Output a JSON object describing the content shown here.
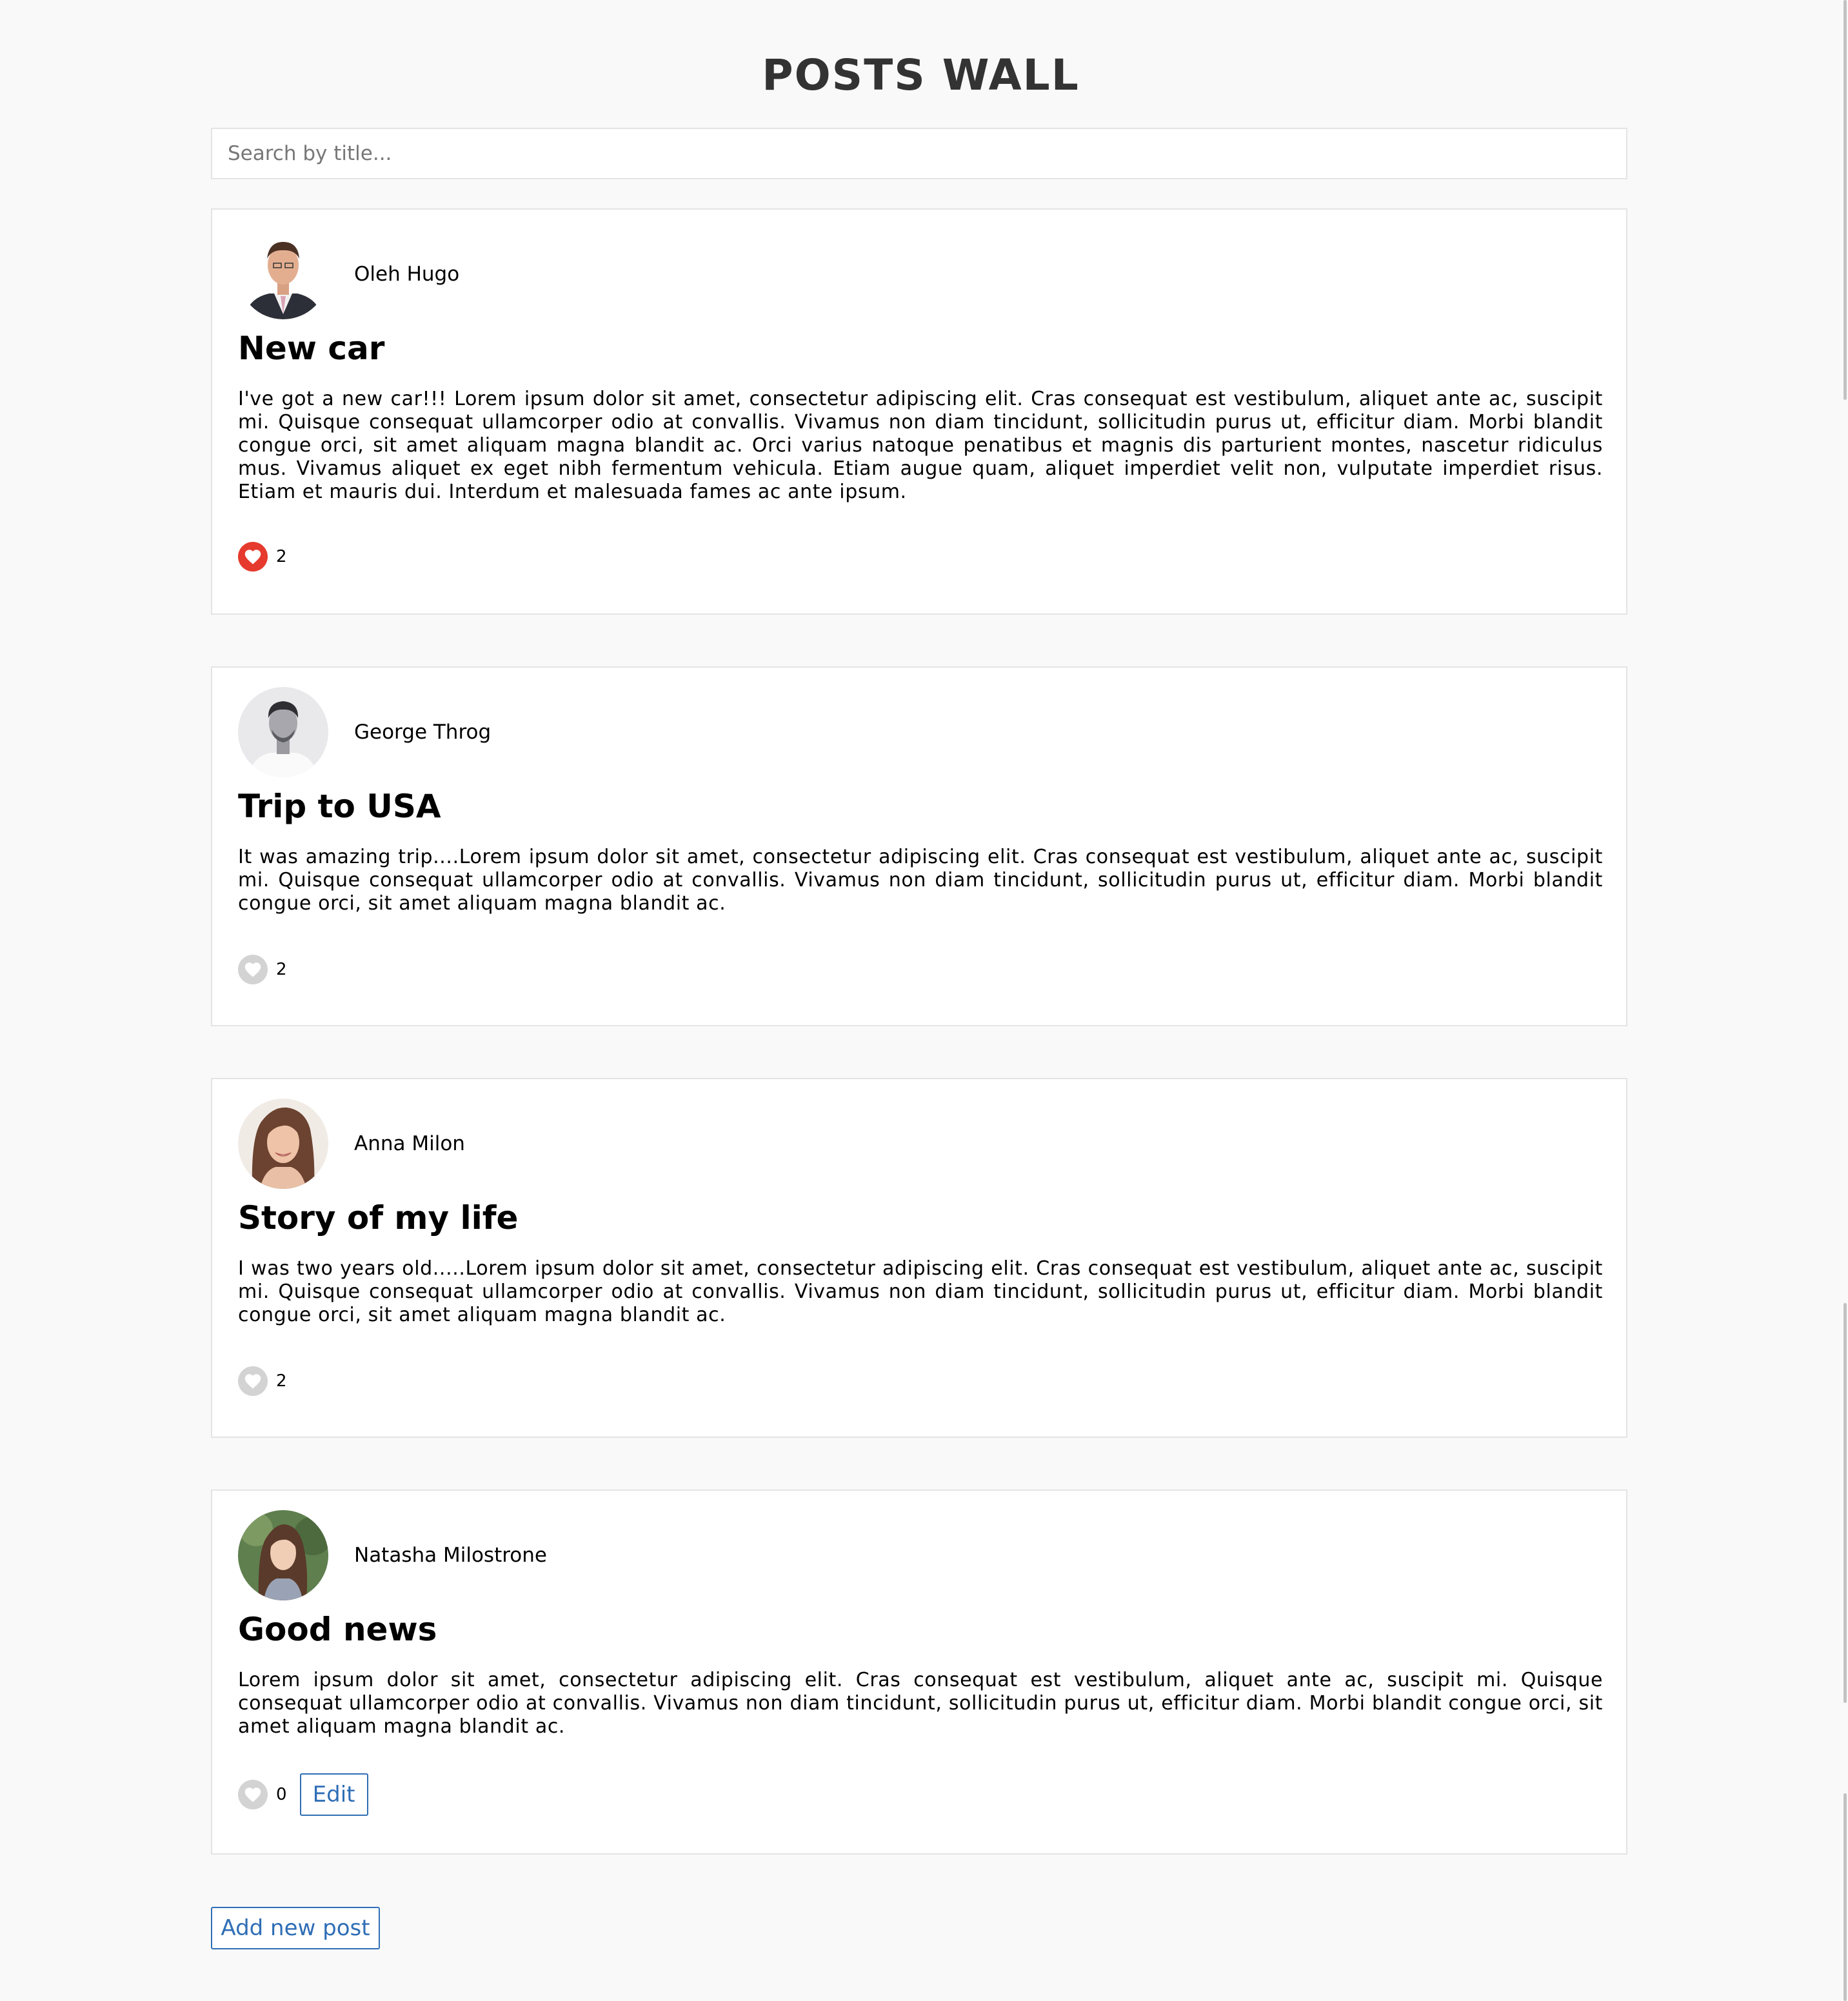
{
  "page": {
    "title": "POSTS WALL"
  },
  "search": {
    "placeholder": "Search by title...",
    "value": ""
  },
  "posts": [
    {
      "author": "Oleh Hugo",
      "title": "New car",
      "body": "I've got a new car!!! Lorem ipsum dolor sit amet, consectetur adipiscing elit. Cras consequat est vestibulum, aliquet ante ac, suscipit mi. Quisque consequat ullamcorper odio at convallis. Vivamus non diam tincidunt, sollicitudin purus ut, efficitur diam. Morbi blandit congue orci, sit amet aliquam magna blandit ac. Orci varius natoque penatibus et magnis dis parturient montes, nascetur ridiculus mus. Vivamus aliquet ex eget nibh fermentum vehicula. Etiam augue quam, aliquet imperdiet velit non, vulputate imperdiet risus. Etiam et mauris dui. Interdum et malesuada fames ac ante ipsum.",
      "likes": "2",
      "liked": true
    },
    {
      "author": "George Throg",
      "title": "Trip to USA",
      "body": "It was amazing trip....Lorem ipsum dolor sit amet, consectetur adipiscing elit. Cras consequat est vestibulum, aliquet ante ac, suscipit mi. Quisque consequat ullamcorper odio at convallis. Vivamus non diam tincidunt, sollicitudin purus ut, efficitur diam. Morbi blandit congue orci, sit amet aliquam magna blandit ac.",
      "likes": "2",
      "liked": false
    },
    {
      "author": "Anna Milon",
      "title": "Story of my life",
      "body": "I was two years old.....Lorem ipsum dolor sit amet, consectetur adipiscing elit. Cras consequat est vestibulum, aliquet ante ac, suscipit mi. Quisque consequat ullamcorper odio at convallis. Vivamus non diam tincidunt, sollicitudin purus ut, efficitur diam. Morbi blandit congue orci, sit amet aliquam magna blandit ac.",
      "likes": "2",
      "liked": false
    },
    {
      "author": "Natasha Milostrone",
      "title": "Good news",
      "body": "Lorem ipsum dolor sit amet, consectetur adipiscing elit. Cras consequat est vestibulum, aliquet ante ac, suscipit mi. Quisque consequat ullamcorper odio at convallis. Vivamus non diam tincidunt, sollicitudin purus ut, efficitur diam. Morbi blandit congue orci, sit amet aliquam magna blandit ac.",
      "likes": "0",
      "liked": false,
      "edit_label": "Edit"
    }
  ],
  "actions": {
    "add_post_label": "Add new post"
  },
  "colors": {
    "background": "#f9f9f9",
    "like_active": "#e53a2d",
    "like_inactive": "#d3d3d3",
    "button_accent": "#2f6eb5"
  },
  "icons": {
    "like": "heart-icon"
  }
}
